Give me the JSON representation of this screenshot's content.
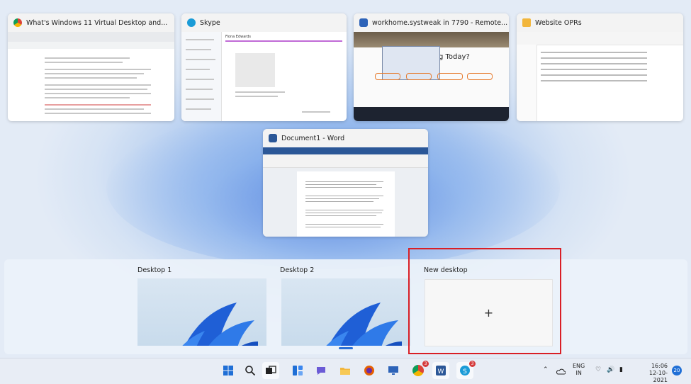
{
  "windows": [
    {
      "title": "What's Windows 11 Virtual Desktop and...",
      "icon": "chrome-icon"
    },
    {
      "title": "Skype",
      "icon": "skype-icon"
    },
    {
      "title": "workhome.systweak in 7790 - Remote...",
      "icon": "remote-desktop-icon"
    },
    {
      "title": "Website OPRs",
      "icon": "folder-icon"
    },
    {
      "title": "Document1 - Word",
      "icon": "word-icon"
    }
  ],
  "skype": {
    "contact": "Fiona Edwards"
  },
  "remote": {
    "heading": "g Today?"
  },
  "desktops": [
    {
      "label": "Desktop 1"
    },
    {
      "label": "Desktop 2"
    },
    {
      "label": "New desktop",
      "action": "+"
    }
  ],
  "taskbar": {
    "icons": [
      "start-icon",
      "search-icon",
      "task-view-icon",
      "widgets-icon",
      "chat-icon",
      "file-explorer-icon",
      "firefox-icon",
      "remote-desktop-icon",
      "chrome-icon",
      "word-icon",
      "skype-icon"
    ],
    "chrome_badge": "3",
    "skype_badge": "3"
  },
  "tray": {
    "lang_top": "ENG",
    "lang_bottom": "IN",
    "time": "16:06",
    "date": "12-10-2021",
    "notifications": "20"
  },
  "colors": {
    "accent": "#2a6fd6",
    "highlight": "#d91f26",
    "word": "#2b5797",
    "skype": "#1a9bd7",
    "folder": "#f2b63c"
  }
}
